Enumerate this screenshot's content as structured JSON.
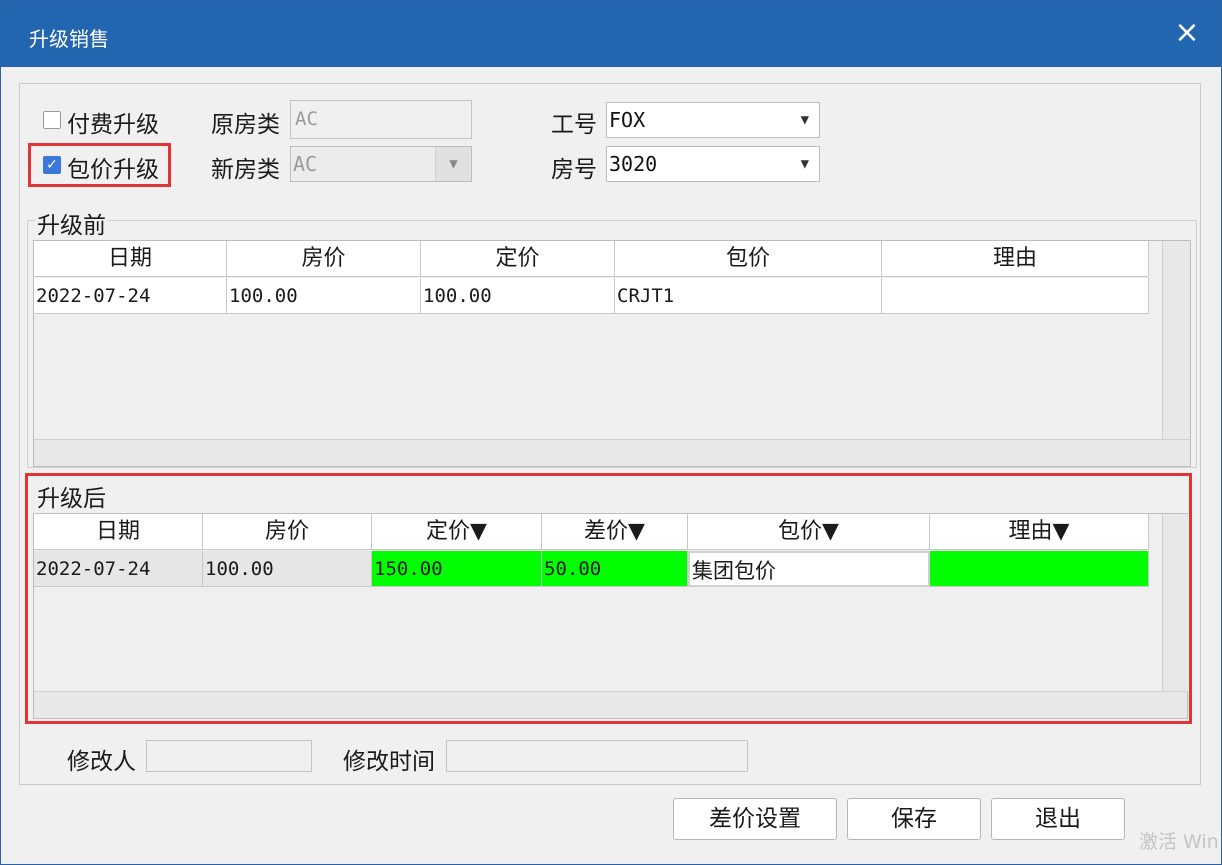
{
  "window": {
    "title": "升级销售",
    "close_icon": "×"
  },
  "options": {
    "paid_upgrade": {
      "label": "付费升级",
      "checked": false
    },
    "package_upgrade": {
      "label": "包价升级",
      "checked": true
    }
  },
  "fields": {
    "orig_room_type": {
      "label": "原房类",
      "value": "AC"
    },
    "new_room_type": {
      "label": "新房类",
      "value": "AC"
    },
    "employee_no": {
      "label": "工号",
      "value": "FOX"
    },
    "room_no": {
      "label": "房号",
      "value": "3020"
    }
  },
  "before": {
    "title": "升级前",
    "columns": [
      "日期",
      "房价",
      "定价",
      "包价",
      "理由"
    ],
    "rows": [
      {
        "date": "2022-07-24",
        "room_price": "100.00",
        "set_price": "100.00",
        "package": "CRJT1",
        "reason": ""
      }
    ]
  },
  "after": {
    "title": "升级后",
    "columns": [
      "日期",
      "房价",
      "定价▼",
      "差价▼",
      "包价▼",
      "理由▼"
    ],
    "rows": [
      {
        "date": "2022-07-24",
        "room_price": "100.00",
        "set_price": "150.00",
        "diff_price": "50.00",
        "package": "集团包价",
        "reason": ""
      }
    ]
  },
  "footer": {
    "modifier_label": "修改人",
    "modifier_value": "",
    "modify_time_label": "修改时间",
    "modify_time_value": ""
  },
  "buttons": {
    "diff_settings": "差价设置",
    "save": "保存",
    "exit": "退出"
  },
  "watermark": "激活 Win",
  "colors": {
    "titlebar": "#2266b0",
    "highlight": "#00ff00",
    "annotation": "#e23434"
  }
}
